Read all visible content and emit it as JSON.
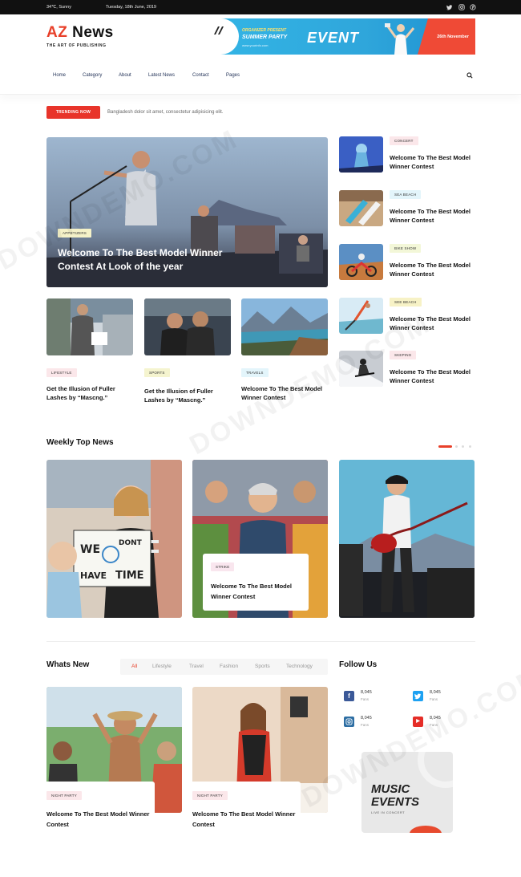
{
  "topbar": {
    "weather": "34℃, Sunny",
    "date": "Tuesday, 18th June, 2019",
    "social_icons": [
      "twitter-icon",
      "instagram-icon",
      "pinterest-icon"
    ]
  },
  "header": {
    "logo_az": "AZ",
    "logo_news": "News",
    "tagline": "THE ART OF PUBLISHING",
    "banner": {
      "line1": "ORGANIZER PRESENT",
      "line2": "SUMMER PARTY",
      "line3": "www.yourinfo.com",
      "event": "EVENT",
      "date": "26th November"
    }
  },
  "nav": {
    "items": [
      "Home",
      "Category",
      "About",
      "Latest News",
      "Contact",
      "Pages"
    ]
  },
  "trending": {
    "label": "TRENDING NOW",
    "text": "Bangladesh dolor sit amet, consectetur adipisicing elit."
  },
  "hero": {
    "tag": "APPETIZERS",
    "title": "Welcome To The Best Model Winner Contest At Look of the year"
  },
  "small_cards": [
    {
      "tag": "LIFESTYLE",
      "title": "Get the Illusion of Fuller Lashes by “Mascng.”"
    },
    {
      "tag": "SPORTS",
      "title": "Get the Illusion of Fuller Lashes by “Mascng.”"
    },
    {
      "tag": "TRAVELS",
      "title": "Welcome To The Best Model Winner Contest"
    }
  ],
  "right_list": [
    {
      "tag": "CONCERT",
      "title": "Welcome To The Best Model Winner Contest",
      "tag_color": "#fbe7ea"
    },
    {
      "tag": "SEA BEACH",
      "title": "Welcome To The Best Model Winner Contest",
      "tag_color": "#e3f5fb"
    },
    {
      "tag": "BIKE SHOW",
      "title": "Welcome To The Best Model Winner Contest",
      "tag_color": "#f3f7d8"
    },
    {
      "tag": "SEE BEACH",
      "title": "Welcome To The Best Model Winner Contest",
      "tag_color": "#f7f2c6"
    },
    {
      "tag": "SKEPING",
      "title": "Welcome To The Best Model Winner Contest",
      "tag_color": "#fbe7ea"
    }
  ],
  "weekly": {
    "title": "Weekly Top News",
    "card_tag": "STRIKE",
    "card_title": "Welcome To The Best Model Winner Contest",
    "sign_text_1": "WE",
    "sign_text_2": "HAVE",
    "sign_text_3": "DONT",
    "sign_text_4": "TIME"
  },
  "whats_new": {
    "title": "Whats New",
    "tabs": [
      "All",
      "Lifestyle",
      "Travel",
      "Fashion",
      "Sports",
      "Technology"
    ],
    "cards": [
      {
        "tag": "NIGHT PARTY",
        "title": "Welcome To The Best Model Winner Contest"
      },
      {
        "tag": "NIGHT PARTY",
        "title": "Welcome To The Best Model Winner Contest"
      }
    ]
  },
  "follow": {
    "title": "Follow Us",
    "items": [
      {
        "count": "8,045",
        "label": "Fans",
        "icon": "facebook-icon",
        "color": "#3b5998",
        "glyph": "f"
      },
      {
        "count": "8,045",
        "label": "Fans",
        "icon": "twitter-icon",
        "color": "#1da1f2",
        "glyph": "t"
      },
      {
        "count": "8,045",
        "label": "Fans",
        "icon": "instagram-icon",
        "color": "#2d6ea3",
        "glyph": "◎"
      },
      {
        "count": "8,045",
        "label": "Fans",
        "icon": "youtube-icon",
        "color": "#e52d27",
        "glyph": "▶"
      }
    ]
  },
  "ad": {
    "line1": "MUSIC",
    "line2": "EVENTS",
    "line3": "LIVE IN CONCERT"
  },
  "watermark": "DOWNDEMO.COM",
  "colors": {
    "accent": "#e8402a",
    "nav": "#1f2f55"
  }
}
